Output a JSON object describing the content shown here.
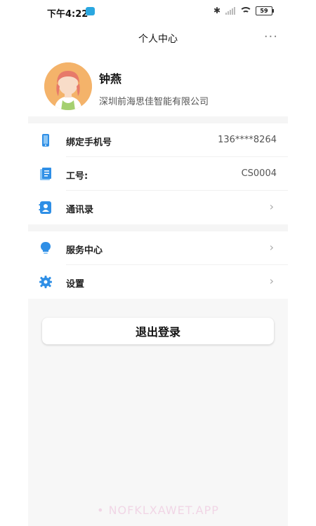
{
  "status_bar": {
    "time": "下午4:22",
    "battery": "59"
  },
  "header": {
    "title": "个人中心",
    "more": "···"
  },
  "profile": {
    "name": "钟燕",
    "company": "深圳前海思佳智能有限公司"
  },
  "menu": {
    "section1": [
      {
        "label": "绑定手机号",
        "value": "136****8264",
        "icon": "phone-icon"
      },
      {
        "label": "工号:",
        "value": "CS0004",
        "icon": "id-card-icon"
      },
      {
        "label": "通讯录",
        "chevron": "›",
        "icon": "contacts-icon"
      }
    ],
    "section2": [
      {
        "label": "服务中心",
        "chevron": "›",
        "icon": "lightbulb-icon"
      },
      {
        "label": "设置",
        "chevron": "›",
        "icon": "gear-icon"
      }
    ]
  },
  "actions": {
    "logout": "退出登录"
  },
  "watermark": "• NOFKLXAWET.APP",
  "colors": {
    "accent": "#2f8fe6",
    "avatar_bg": "#f4b36a",
    "page_bg": "#f7f7f7"
  }
}
